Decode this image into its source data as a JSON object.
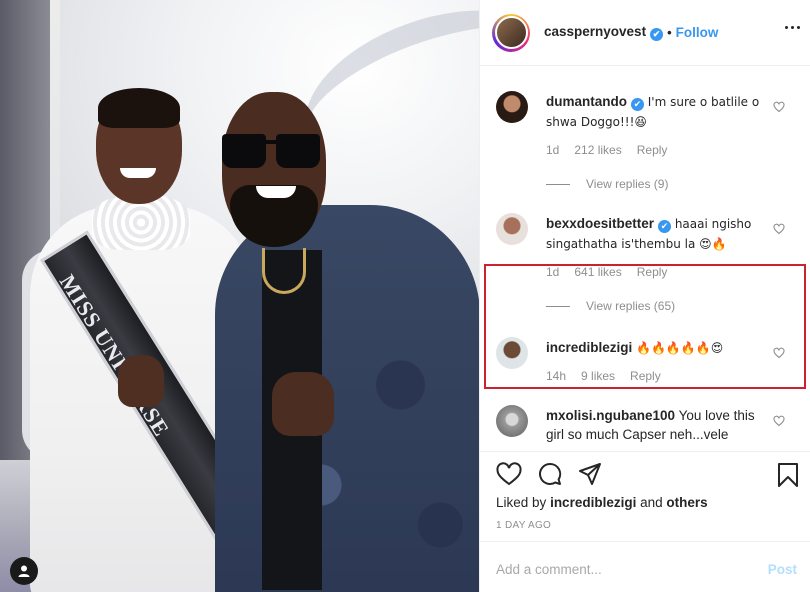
{
  "header": {
    "username": "cassper­nyovest",
    "verified_mark": "✔",
    "separator": "•",
    "follow_label": "Follow"
  },
  "photo": {
    "sash_text": "MISS UNIVERSE"
  },
  "comments": [
    {
      "username": "dumantando",
      "verified": true,
      "text": "I'm sure o batlile o shwa Doggo!!!😆",
      "time": "1d",
      "likes": "212 likes",
      "reply": "Reply",
      "view_replies": "View replies (9)"
    },
    {
      "username": "bexxdoesitbetter",
      "verified": true,
      "text": "haaai ngisho singathatha is'thembu la 😍🔥",
      "time": "1d",
      "likes": "641 likes",
      "reply": "Reply",
      "view_replies": "View replies (65)"
    },
    {
      "username": "incrediblezigi",
      "verified": false,
      "text": "🔥🔥🔥🔥🔥😍",
      "time": "14h",
      "likes": "9 likes",
      "reply": "Reply"
    },
    {
      "username": "mxolisi.ngubane100",
      "verified": false,
      "text": "You love this girl so much Capser neh...vele"
    }
  ],
  "actions": {
    "liked_by_prefix": "Liked by",
    "liked_by_user": "incrediblezigi",
    "liked_by_and": "and",
    "liked_by_others": "others",
    "date": "1 DAY AGO"
  },
  "add_comment": {
    "placeholder": "Add a comment...",
    "post_label": "Post"
  },
  "colors": {
    "accent": "#3897f0",
    "highlight_box": "#cc2230",
    "muted": "#8e8e8e"
  }
}
